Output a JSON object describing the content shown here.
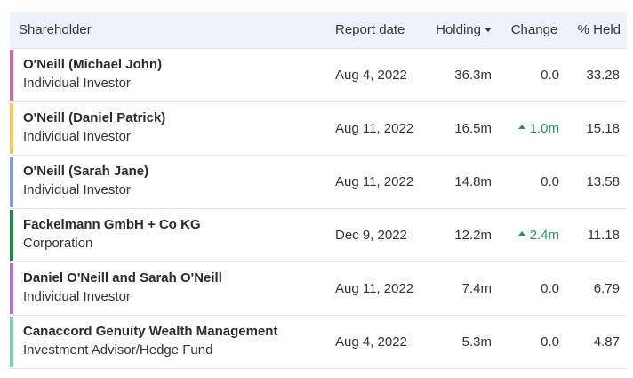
{
  "table": {
    "headers": {
      "shareholder": "Shareholder",
      "report_date": "Report date",
      "holding": "Holding",
      "change": "Change",
      "held": "% Held"
    },
    "colors": {
      "up": "#1f9a53",
      "header_bg": "#eef3fb"
    },
    "rows": [
      {
        "name": "O'Neill (Michael John)",
        "type": "Individual Investor",
        "date": "Aug 4, 2022",
        "holding": "36.3m",
        "change": "0.0",
        "change_direction": "none",
        "held": "33.28",
        "color": "#d36a9b"
      },
      {
        "name": "O'Neill (Daniel Patrick)",
        "type": "Individual Investor",
        "date": "Aug 11, 2022",
        "holding": "16.5m",
        "change": "1.0m",
        "change_direction": "up",
        "held": "15.18",
        "color": "#f1c75b"
      },
      {
        "name": "O'Neill (Sarah Jane)",
        "type": "Individual Investor",
        "date": "Aug 11, 2022",
        "holding": "14.8m",
        "change": "0.0",
        "change_direction": "none",
        "held": "13.58",
        "color": "#7b9fe0"
      },
      {
        "name": "Fackelmann GmbH + Co KG",
        "type": "Corporation",
        "date": "Dec 9, 2022",
        "holding": "12.2m",
        "change": "2.4m",
        "change_direction": "up",
        "held": "11.18",
        "color": "#1f8a3d"
      },
      {
        "name": "Daniel O'Neill and Sarah O'Neill",
        "type": "Individual Investor",
        "date": "Aug 11, 2022",
        "holding": "7.4m",
        "change": "0.0",
        "change_direction": "none",
        "held": "6.79",
        "color": "#b070d8"
      },
      {
        "name": "Canaccord Genuity Wealth Management",
        "type": "Investment Advisor/Hedge Fund",
        "date": "Aug 4, 2022",
        "holding": "5.3m",
        "change": "0.0",
        "change_direction": "none",
        "held": "4.87",
        "color": "#7fd0a8"
      }
    ]
  }
}
